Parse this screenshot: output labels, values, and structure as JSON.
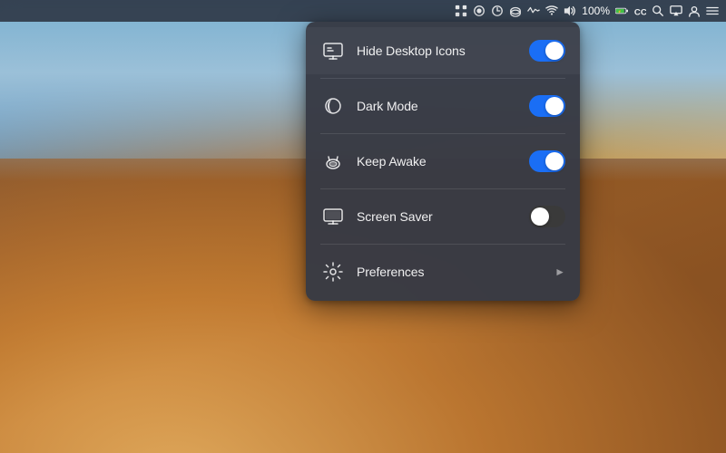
{
  "desktop": {
    "bg_description": "macOS Mojave desert wallpaper"
  },
  "menubar": {
    "battery_percent": "100%",
    "icons": [
      {
        "name": "app-switcher-icon",
        "symbol": "⠿"
      },
      {
        "name": "screen-record-icon",
        "symbol": "⊙"
      },
      {
        "name": "timer-icon",
        "symbol": "◔"
      },
      {
        "name": "airdrop-icon",
        "symbol": "↑"
      },
      {
        "name": "activity-icon",
        "symbol": "⌗"
      },
      {
        "name": "wifi-icon",
        "symbol": "wifi"
      },
      {
        "name": "volume-icon",
        "symbol": "vol"
      },
      {
        "name": "battery-icon",
        "symbol": "batt"
      },
      {
        "name": "creative-cloud-icon",
        "symbol": "CC"
      },
      {
        "name": "search-icon",
        "symbol": "🔍"
      },
      {
        "name": "airplay-icon",
        "symbol": "▭"
      },
      {
        "name": "user-icon",
        "symbol": "👤"
      },
      {
        "name": "menu-extras-icon",
        "symbol": "☰"
      }
    ]
  },
  "dropdown": {
    "items": [
      {
        "id": "hide-desktop-icons",
        "label": "Hide Desktop Icons",
        "icon": "desktop-hide-icon",
        "control": "toggle",
        "state": "on",
        "has_submenu": false
      },
      {
        "id": "dark-mode",
        "label": "Dark Mode",
        "icon": "dark-mode-icon",
        "control": "toggle",
        "state": "on",
        "has_submenu": false
      },
      {
        "id": "keep-awake",
        "label": "Keep Awake",
        "icon": "keep-awake-icon",
        "control": "toggle",
        "state": "on",
        "has_submenu": false
      },
      {
        "id": "screen-saver",
        "label": "Screen Saver",
        "icon": "screen-saver-icon",
        "control": "toggle",
        "state": "off",
        "has_submenu": false
      },
      {
        "id": "preferences",
        "label": "Preferences",
        "icon": "preferences-icon",
        "control": "chevron",
        "state": null,
        "has_submenu": true
      }
    ]
  }
}
